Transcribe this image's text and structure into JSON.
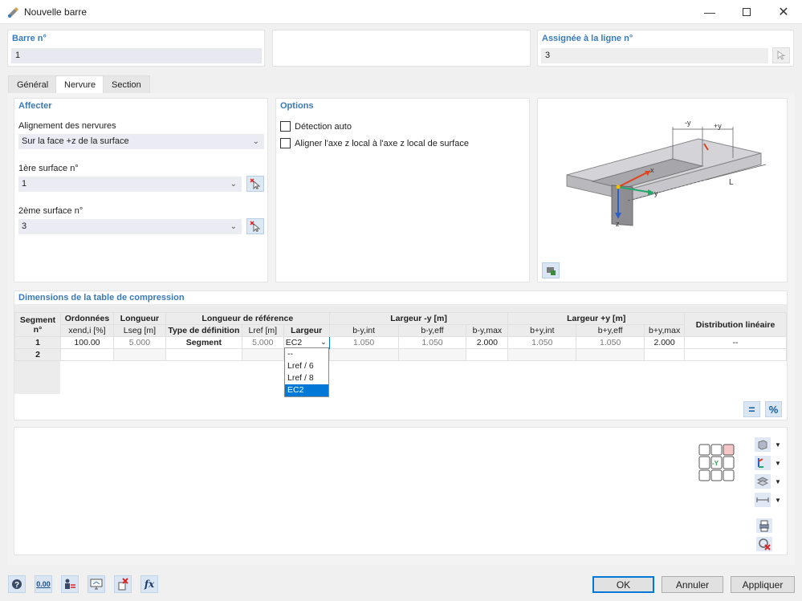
{
  "window": {
    "title": "Nouvelle barre",
    "min_icon": "minimize-icon",
    "max_icon": "maximize-icon",
    "close_icon": "close-icon"
  },
  "header": {
    "barre_label": "Barre n°",
    "barre_value": "1",
    "assigned_label": "Assignée à la ligne n°",
    "assigned_value": "3"
  },
  "tabs": [
    {
      "label": "Général"
    },
    {
      "label": "Nervure"
    },
    {
      "label": "Section"
    }
  ],
  "affecter": {
    "title": "Affecter",
    "alignment_label": "Alignement des nervures",
    "alignment_value": "Sur la face +z de la surface",
    "surface1_label": "1ère surface n°",
    "surface1_value": "1",
    "surface2_label": "2ème surface n°",
    "surface2_value": "3"
  },
  "options": {
    "title": "Options",
    "auto_detect_label": "Détection auto",
    "align_axis_label": "Aligner l'axe z local à l'axe z local de surface"
  },
  "diagram": {
    "minus_y": "-y",
    "plus_y": "+y",
    "x": "x",
    "y": "y",
    "z": "z",
    "L": "L"
  },
  "compression_table": {
    "title": "Dimensions de la table de compression",
    "headers": {
      "segment": "Segment n°",
      "ordonnees": "Ordonnées",
      "xend": "xend,i [%]",
      "longueur": "Longueur",
      "lseg": "Lseg [m]",
      "longueur_ref": "Longueur de référence",
      "type_def": "Type de définition",
      "lref": "Lref [m]",
      "largeur": "Largeur",
      "largeur_minus": "Largeur -y [m]",
      "b_y_int": "b-y,int",
      "b_y_eff": "b-y,eff",
      "b_y_max": "b-y,max",
      "largeur_plus": "Largeur +y [m]",
      "bp_y_int": "b+y,int",
      "bp_y_eff": "b+y,eff",
      "bp_y_max": "b+y,max",
      "distribution": "Distribution linéaire"
    },
    "rows": [
      {
        "segment": "1",
        "xend": "100.00",
        "lseg": "5.000",
        "type": "Segment",
        "lref": "5.000",
        "largeur": "EC2",
        "b_y_int": "1.050",
        "b_y_eff": "1.050",
        "b_y_max": "2.000",
        "bp_y_int": "1.050",
        "bp_y_eff": "1.050",
        "bp_y_max": "2.000",
        "distribution": "--"
      },
      {
        "segment": "2"
      }
    ],
    "dropdown_options": [
      "--",
      "Lref / 6",
      "Lref / 8",
      "EC2"
    ],
    "dropdown_selected": "EC2"
  },
  "footer": {
    "ok": "OK",
    "cancel": "Annuler",
    "apply": "Appliquer"
  },
  "colors": {
    "accent": "#0078d7",
    "group_title": "#3a7ab8",
    "selected": "#0078d7"
  }
}
